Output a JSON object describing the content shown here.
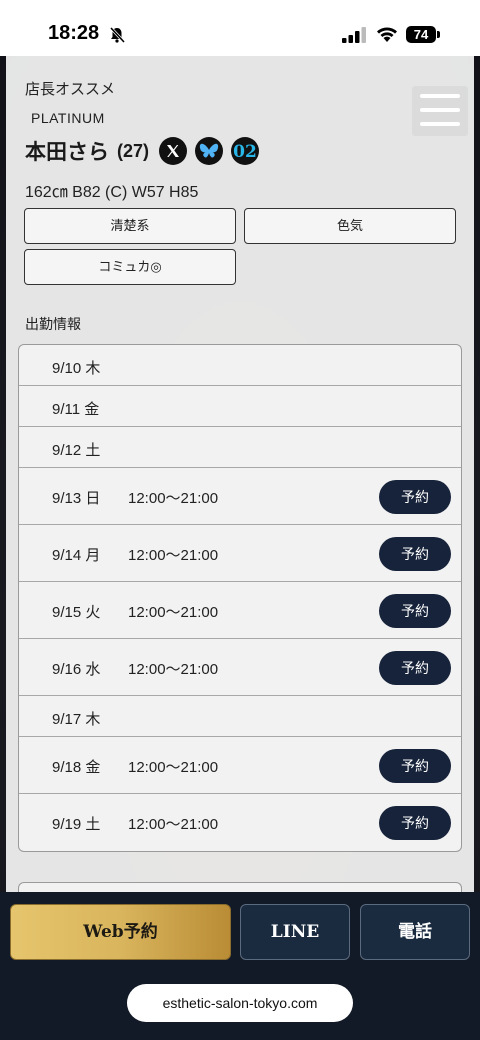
{
  "status_bar": {
    "time": "18:28",
    "battery": "74"
  },
  "profile": {
    "recommend_label": "店長オススメ",
    "rank": "PLATINUM",
    "name": "本田さら",
    "age": "(27)",
    "measurements": "162㎝ B82 (C) W57 H85",
    "tags": [
      "清楚系",
      "色気",
      "コミュカ◎"
    ],
    "sns_icons": [
      "x-icon",
      "bluesky-icon",
      "o2-icon"
    ]
  },
  "schedule": {
    "title": "出勤情報",
    "reserve_label": "予約",
    "rows": [
      {
        "date": "9/10 木",
        "time": ""
      },
      {
        "date": "9/11 金",
        "time": ""
      },
      {
        "date": "9/12 土",
        "time": ""
      },
      {
        "date": "9/13 日",
        "time": "12:00〜21:00"
      },
      {
        "date": "9/14 月",
        "time": "12:00〜21:00"
      },
      {
        "date": "9/15 火",
        "time": "12:00〜21:00"
      },
      {
        "date": "9/16 水",
        "time": "12:00〜21:00"
      },
      {
        "date": "9/17 木",
        "time": ""
      },
      {
        "date": "9/18 金",
        "time": "12:00〜21:00"
      },
      {
        "date": "9/19 土",
        "time": "12:00〜21:00"
      }
    ]
  },
  "bottom_nav": {
    "web_label": "Web予約",
    "line_label": "LINE",
    "tel_label": "電話"
  },
  "browser": {
    "url": "esthetic-salon-tokyo.com"
  },
  "colors": {
    "accent_gold": "#d9b55d",
    "navy": "#17233a"
  }
}
